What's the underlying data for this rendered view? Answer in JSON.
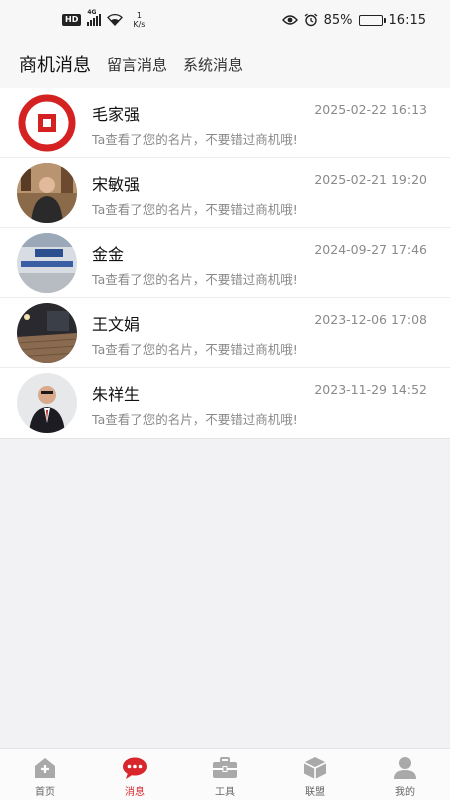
{
  "status_bar": {
    "hd": "HD",
    "net": "4G",
    "speed_value": "1",
    "speed_unit": "K/s",
    "battery_percent": "85%",
    "time": "16:15",
    "battery_level": 0.85
  },
  "header": {
    "tabs": [
      {
        "label": "商机消息",
        "active": true
      },
      {
        "label": "留言消息",
        "active": false
      },
      {
        "label": "系统消息",
        "active": false
      }
    ]
  },
  "messages": [
    {
      "name": "毛家强",
      "time": "2025-02-22 16:13",
      "preview": "Ta查看了您的名片，不要错过商机哦!",
      "avatar": "red-logo"
    },
    {
      "name": "宋敏强",
      "time": "2025-02-21 19:20",
      "preview": "Ta查看了您的名片，不要错过商机哦!",
      "avatar": "photo-man-shelf"
    },
    {
      "name": "金金",
      "time": "2024-09-27 17:46",
      "preview": "Ta查看了您的名片，不要错过商机哦!",
      "avatar": "photo-office-sign"
    },
    {
      "name": "王文娟",
      "time": "2023-12-06 17:08",
      "preview": "Ta查看了您的名片，不要错过商机哦!",
      "avatar": "photo-night-street"
    },
    {
      "name": "朱祥生",
      "time": "2023-11-29 14:52",
      "preview": "Ta查看了您的名片，不要错过商机哦!",
      "avatar": "photo-man-suit"
    }
  ],
  "tabbar": {
    "items": [
      {
        "label": "首页",
        "icon": "home-icon",
        "active": false
      },
      {
        "label": "消息",
        "icon": "message-icon",
        "active": true
      },
      {
        "label": "工具",
        "icon": "toolbox-icon",
        "active": false
      },
      {
        "label": "联盟",
        "icon": "cube-icon",
        "active": false
      },
      {
        "label": "我的",
        "icon": "user-icon",
        "active": false
      }
    ]
  },
  "colors": {
    "accent": "#d9262c",
    "inactive_icon": "#a9a9a9"
  }
}
